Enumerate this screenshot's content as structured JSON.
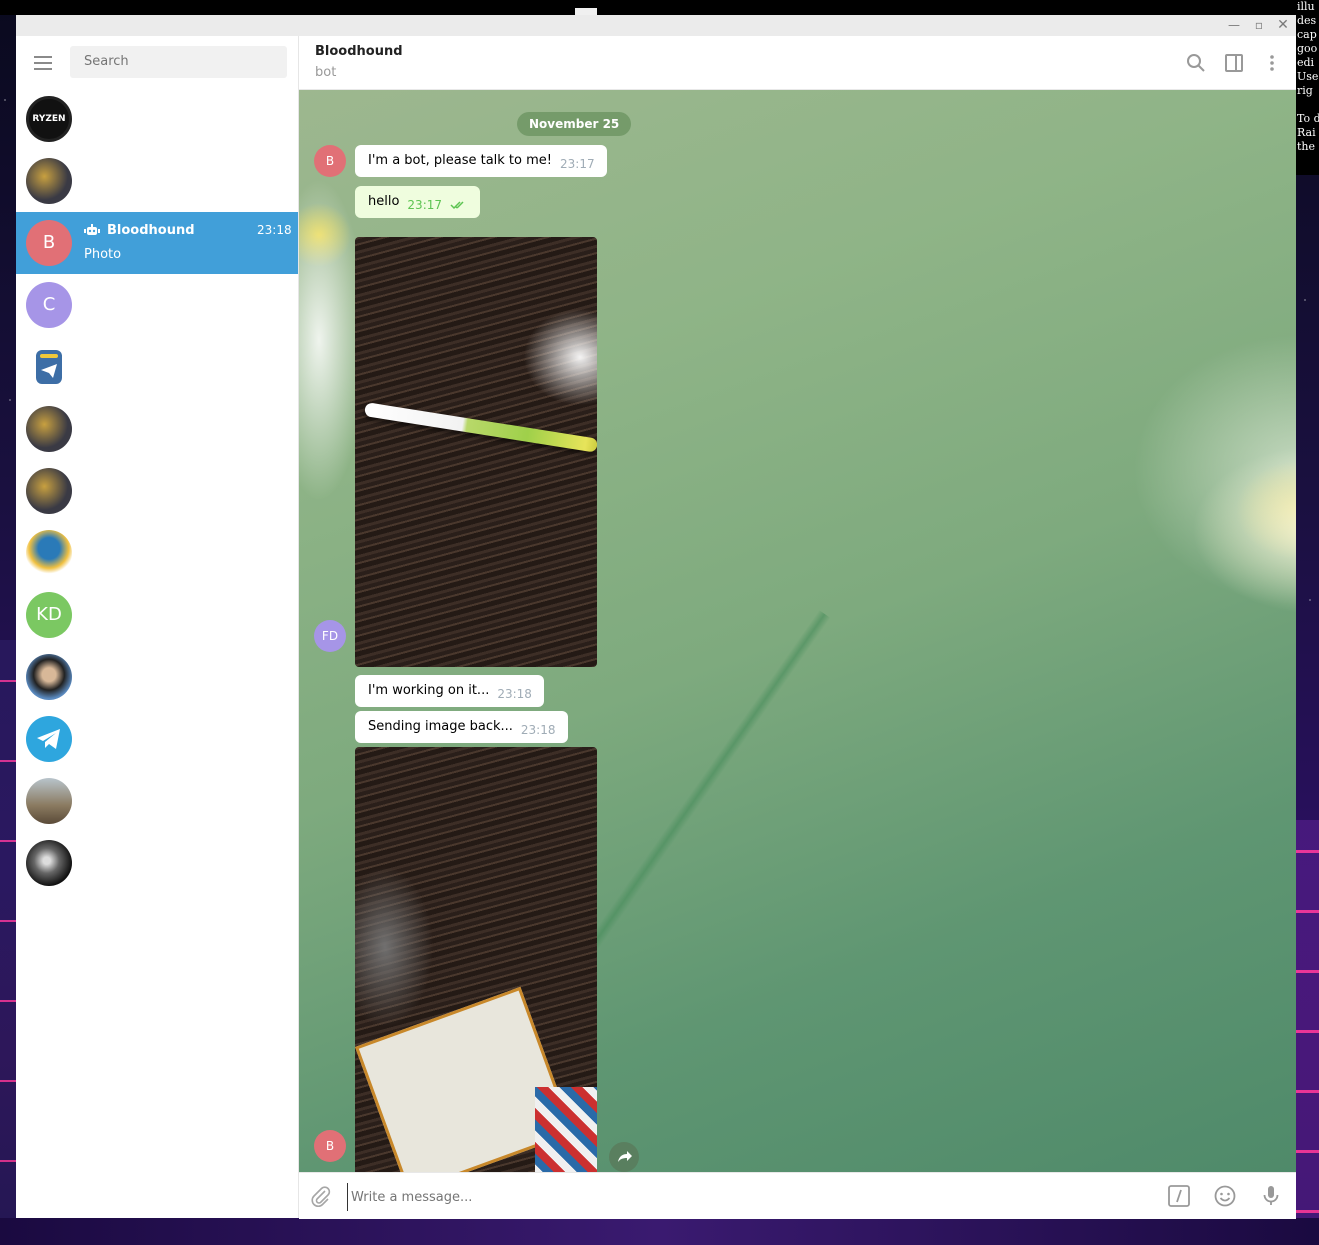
{
  "desktop": {
    "note_lines": [
      "illu",
      "des",
      "cap",
      "goo",
      "edi",
      "Use",
      "rig",
      "",
      "To d",
      "Rai",
      "the"
    ]
  },
  "window": {
    "controls": {
      "minimize": "—",
      "maximize": "▫",
      "close": "✕"
    }
  },
  "sidebar": {
    "search_placeholder": "Search",
    "chats": [
      {
        "avatar": "RYZEN",
        "avatar_color": "#111111",
        "active": false
      },
      {
        "avatar": "",
        "avatar_color": "#4a4a52",
        "active": false
      },
      {
        "avatar": "B",
        "avatar_color": "#e17076",
        "name": "Bloodhound",
        "time": "23:18",
        "preview": "Photo",
        "is_bot": true,
        "active": true
      },
      {
        "avatar": "C",
        "avatar_color": "#a695e7",
        "active": false
      },
      {
        "avatar": "",
        "avatar_color": "#3d6ea6",
        "active": false
      },
      {
        "avatar": "",
        "avatar_color": "#4a4a52",
        "active": false
      },
      {
        "avatar": "",
        "avatar_color": "#4a4a52",
        "active": false
      },
      {
        "avatar": "",
        "avatar_color": "#2a7ab8",
        "active": false
      },
      {
        "avatar": "KD",
        "avatar_color": "#7bc862",
        "active": false
      },
      {
        "avatar": "",
        "avatar_color": "#5a8ac0",
        "active": false
      },
      {
        "avatar": "",
        "avatar_color": "#2ea6de",
        "active": false
      },
      {
        "avatar": "",
        "avatar_color": "#7a6a55",
        "active": false
      },
      {
        "avatar": "",
        "avatar_color": "#222222",
        "active": false
      }
    ]
  },
  "header": {
    "name": "Bloodhound",
    "status": "bot",
    "icons": [
      "search-icon",
      "sidebar-toggle-icon",
      "more-vertical-icon"
    ]
  },
  "chat": {
    "date": "November 25",
    "messages": [
      {
        "avatar": "B",
        "text": "I'm a bot, please talk to me!",
        "time": "23:17",
        "outgoing": false
      },
      {
        "avatar": "FD",
        "text": "hello",
        "time": "23:17",
        "outgoing": true
      },
      {
        "avatar": "B",
        "text": "I'm working on it...",
        "time": "23:18",
        "outgoing": false
      },
      {
        "text": "Sending image back...",
        "time": "23:18",
        "outgoing": false
      }
    ],
    "avatar_colors": {
      "B": "#e17076",
      "FD": "#a695e7"
    }
  },
  "composer": {
    "placeholder": "Write a message...",
    "icons": [
      "attach-icon",
      "bot-commands-icon",
      "emoji-icon",
      "microphone-icon"
    ]
  }
}
